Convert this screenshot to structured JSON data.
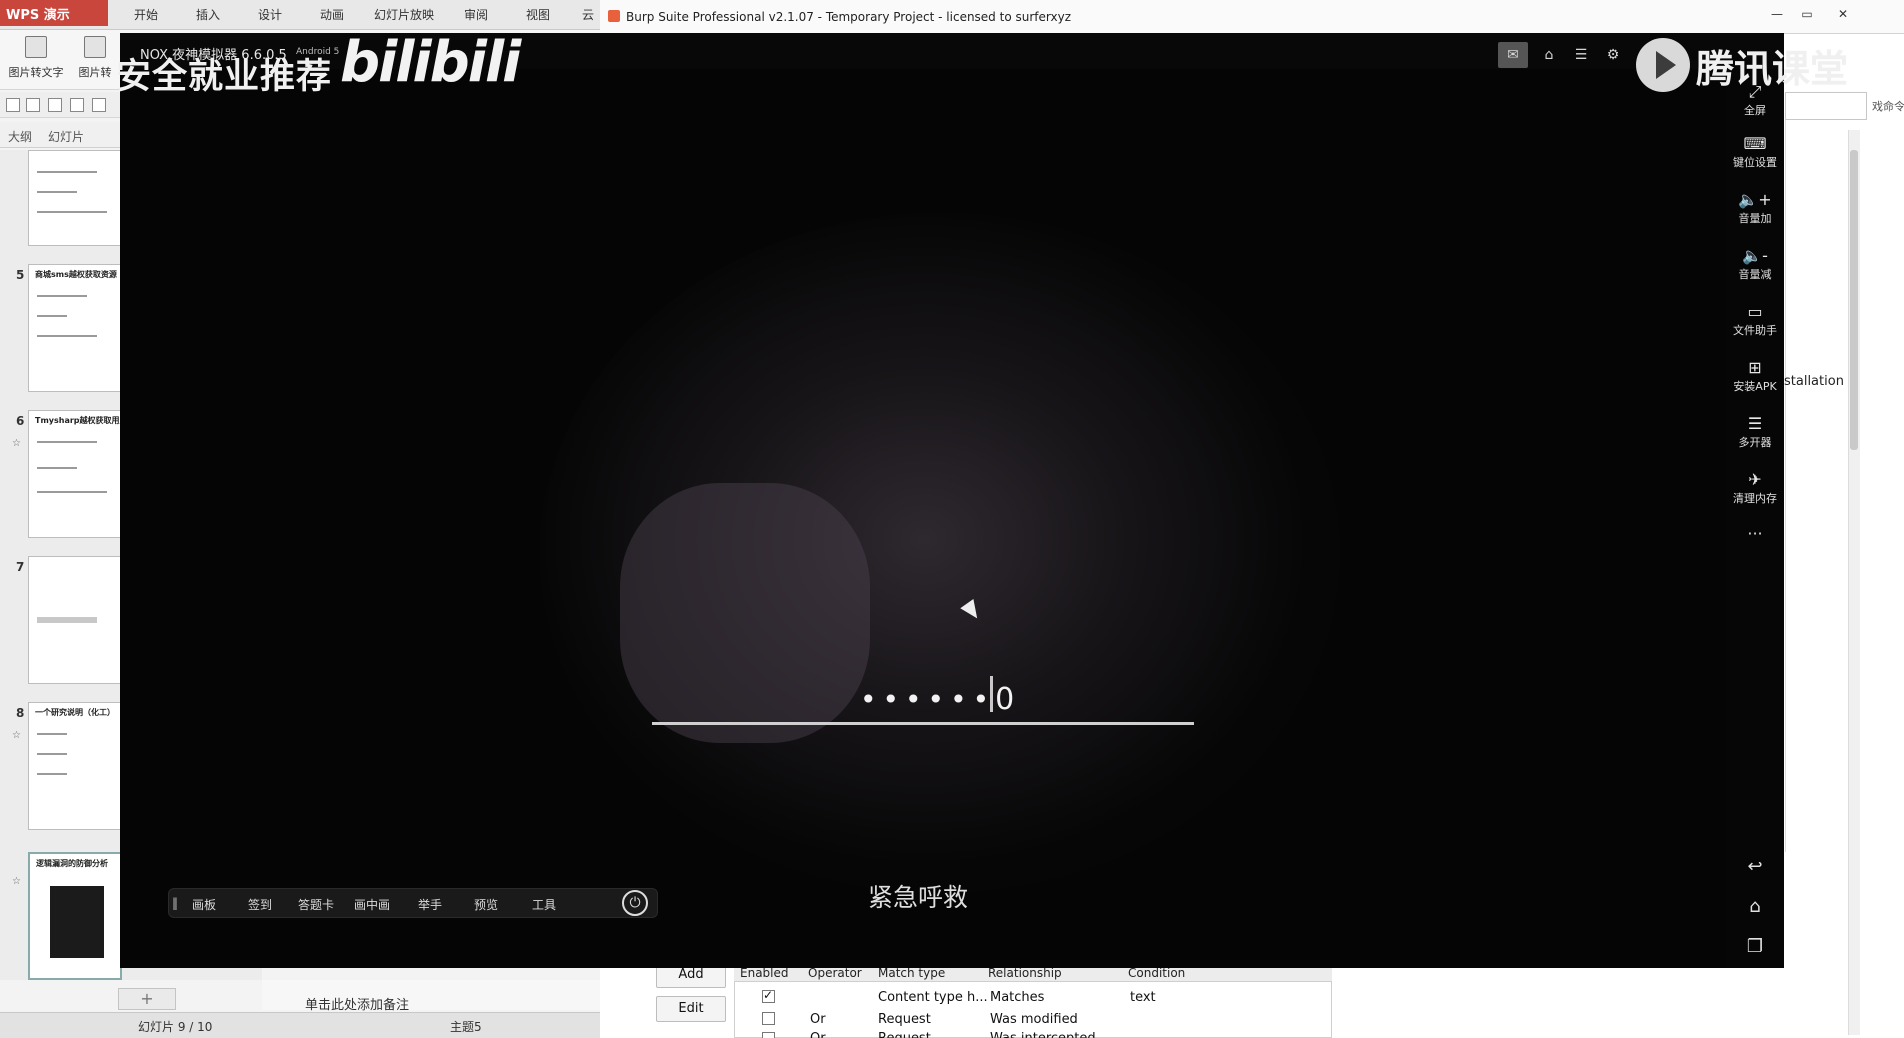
{
  "wps": {
    "app_button": "WPS 演示",
    "menu": [
      "开始",
      "插入",
      "设计",
      "动画",
      "幻灯片放映",
      "审阅",
      "视图",
      "云"
    ],
    "ribbon": [
      "图片转文字",
      "图片转"
    ],
    "panel_tabs": [
      "大纲",
      "幻灯片"
    ],
    "slides": [
      {
        "num": "5",
        "title": "商城sms越权获取资源"
      },
      {
        "num": "6",
        "title": "Tmysharp越权获取用户信息"
      },
      {
        "num": "7",
        "title": ""
      },
      {
        "num": "8",
        "title": "一个研究说明（化工）"
      },
      {
        "num": "",
        "title": "逻辑漏洞的防御分析"
      }
    ],
    "notes_placeholder": "单击此处添加备注",
    "status_slide": "幻灯片 9 / 10",
    "status_theme": "主题5",
    "add_slide": "+"
  },
  "burp": {
    "title": "Burp Suite Professional v2.1.07 - Temporary Project - licensed to surferxyz",
    "right_text": "stallation",
    "right_input": "戏命令",
    "buttons": {
      "add": "Add",
      "edit": "Edit"
    },
    "table": {
      "headers": [
        "Enabled",
        "Operator",
        "Match type",
        "Relationship",
        "Condition"
      ],
      "rows": [
        {
          "enabled": true,
          "operator": "",
          "match_type": "Content type h...",
          "relationship": "Matches",
          "condition": "text"
        },
        {
          "enabled": false,
          "operator": "Or",
          "match_type": "Request",
          "relationship": "Was modified",
          "condition": ""
        },
        {
          "enabled": false,
          "operator": "Or",
          "match_type": "Request",
          "relationship": "Was intercepted",
          "condition": ""
        }
      ]
    }
  },
  "emulator": {
    "title": "NOX 夜神模拟器 6.6.0.5",
    "android": "Android 5",
    "sidebar": [
      {
        "label": "全屏",
        "icon": "fullscreen-icon",
        "glyph": "⤢"
      },
      {
        "label": "键位设置",
        "icon": "keyboard-icon",
        "glyph": "⌨"
      },
      {
        "label": "音量加",
        "icon": "volume-up-icon",
        "glyph": "🔈+"
      },
      {
        "label": "音量减",
        "icon": "volume-down-icon",
        "glyph": "🔈-"
      },
      {
        "label": "文件助手",
        "icon": "file-assistant-icon",
        "glyph": "▭"
      },
      {
        "label": "安装APK",
        "icon": "install-apk-icon",
        "glyph": "⊞"
      },
      {
        "label": "多开器",
        "icon": "multi-instance-icon",
        "glyph": "☰"
      },
      {
        "label": "清理内存",
        "icon": "clean-memory-icon",
        "glyph": "✈"
      }
    ],
    "more": "···",
    "password_dots": "••••••",
    "password_last": "0",
    "emergency_call": "紧急呼救",
    "toolbar": [
      "画板",
      "签到",
      "答题卡",
      "画中画",
      "举手",
      "预览",
      "工具"
    ]
  },
  "watermarks": {
    "left": "安全就业推荐",
    "bilibili": "bilibili",
    "right": "腾讯课堂"
  },
  "colors": {
    "wps_accent": "#c9463d",
    "burp_accent": "#e8603c",
    "emulator_bg": "#050505"
  }
}
